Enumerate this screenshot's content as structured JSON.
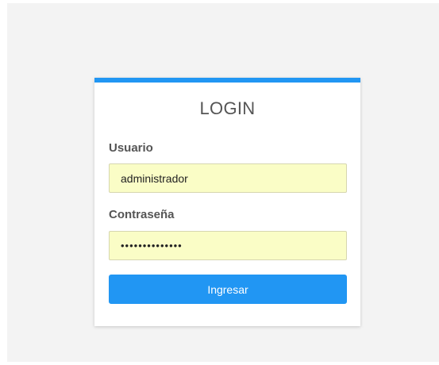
{
  "colors": {
    "accent": "#2196f3",
    "input_background": "#fafdc6",
    "page_background": "#f3f3f3"
  },
  "login": {
    "title": "LOGIN",
    "username_label": "Usuario",
    "username_value": "administrador",
    "password_label": "Contraseña",
    "password_value": "••••••••••••••",
    "submit_label": "Ingresar"
  }
}
